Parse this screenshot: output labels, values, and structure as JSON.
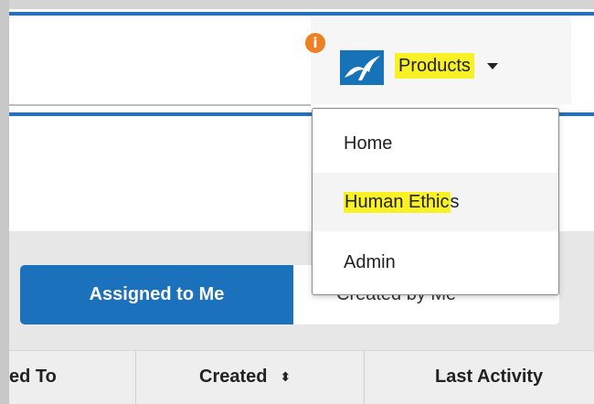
{
  "header": {
    "notification_badge": "i",
    "products_label": "Products",
    "logo_icon": "bird-logo-icon",
    "caret_icon": "caret-down-icon"
  },
  "products_menu": {
    "items": [
      {
        "label": "Home"
      },
      {
        "label_highlighted": "Human Ethic",
        "label_rest": "s"
      },
      {
        "label": "Admin"
      }
    ]
  },
  "tabs": [
    {
      "label": "Assigned to Me",
      "active": true
    },
    {
      "label": "Created by Me",
      "active": false
    }
  ],
  "table": {
    "columns": [
      {
        "label": "ed To"
      },
      {
        "label": "Created",
        "sort_icon": "⬍"
      },
      {
        "label": "Last Activity"
      }
    ]
  },
  "colors": {
    "accent_blue": "#1b71bc",
    "highlight_yellow": "#f7f125",
    "badge_orange": "#ee7f22"
  }
}
